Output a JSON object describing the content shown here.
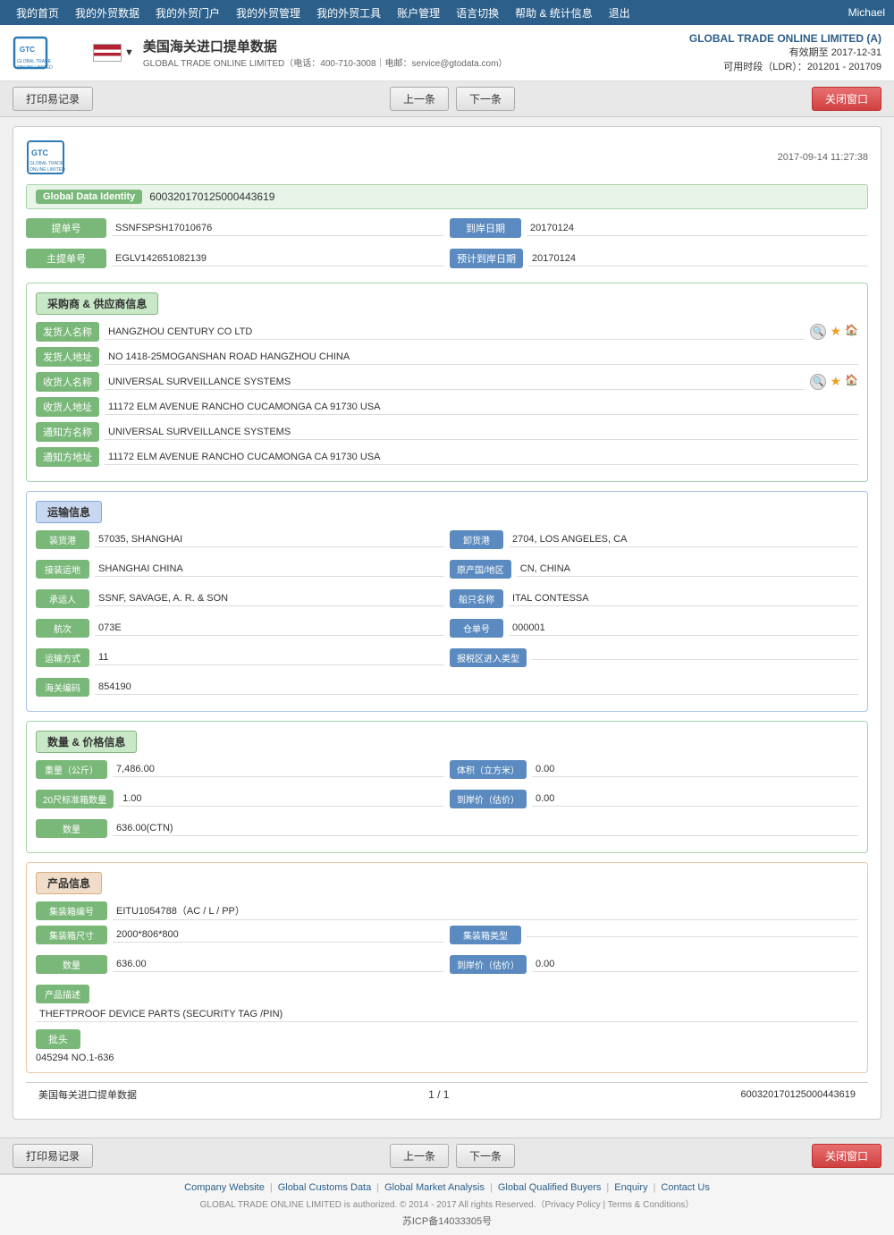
{
  "topnav": {
    "items": [
      {
        "label": "我的首页",
        "id": "home"
      },
      {
        "label": "我的外贸数据",
        "id": "data"
      },
      {
        "label": "我的外贸门户",
        "id": "portal"
      },
      {
        "label": "我的外贸管理",
        "id": "manage"
      },
      {
        "label": "我的外贸工具",
        "id": "tools"
      },
      {
        "label": "账户管理",
        "id": "account"
      },
      {
        "label": "语言切换",
        "id": "lang"
      },
      {
        "label": "帮助 & 统计信息",
        "id": "help"
      },
      {
        "label": "退出",
        "id": "logout"
      }
    ],
    "user": "Michael"
  },
  "header": {
    "title": "美国海关进口提单数据",
    "subtitle": "GLOBAL TRADE ONLINE LIMITED（电话：400-710-3008｜电邮：service@gtodata.com）",
    "brand": "GLOBAL TRADE ONLINE LIMITED (A)",
    "expiry_label": "有效期至",
    "expiry_date": "2017-12-31",
    "time_label": "可用时段（LDR）：",
    "time_range": "201201 - 201709"
  },
  "toolbar": {
    "print_label": "打印易记录",
    "prev_label": "上一条",
    "next_label": "下一条",
    "close_label": "关闭窗口"
  },
  "card": {
    "datetime": "2017-09-14 11:27:38",
    "global_data_label": "Global Data Identity",
    "global_data_value": "600320170125000443619",
    "fields": {
      "ti_dan_hao": {
        "label": "提单号",
        "value": "SSNFSPSH17010676"
      },
      "dao_an_ri_qi": {
        "label": "到岸日期",
        "value": "20170124"
      },
      "zhu_ti_dan_hao": {
        "label": "主提单号",
        "value": "EGLV142651082139"
      },
      "yu_ji_dao_an_ri_qi": {
        "label": "预计到岸日期",
        "value": "20170124"
      }
    }
  },
  "supplier_section": {
    "title": "采购商 & 供应商信息",
    "fields": {
      "fa_huo_ren_mingcheng": {
        "label": "发货人名称",
        "value": "HANGZHOU CENTURY CO LTD"
      },
      "fa_huo_ren_dizhi": {
        "label": "发货人地址",
        "value": "NO 1418-25MOGANSHAN ROAD HANGZHOU CHINA"
      },
      "shou_huo_ren_mingcheng": {
        "label": "收货人名称",
        "value": "UNIVERSAL SURVEILLANCE SYSTEMS"
      },
      "shou_huo_ren_dizhi": {
        "label": "收货人地址",
        "value": "11172 ELM AVENUE RANCHO CUCAMONGA CA 91730 USA"
      },
      "tong_zhi_fang_mingcheng": {
        "label": "通知方名称",
        "value": "UNIVERSAL SURVEILLANCE SYSTEMS"
      },
      "tong_zhi_fang_dizhi": {
        "label": "通知方地址",
        "value": "11172 ELM AVENUE RANCHO CUCAMONGA CA 91730 USA"
      }
    }
  },
  "transport_section": {
    "title": "运输信息",
    "fields": {
      "zhuang_huo_gang": {
        "label": "装货港",
        "value": "57035, SHANGHAI"
      },
      "xie_huo_gang": {
        "label": "卸货港",
        "value": "2704, LOS ANGELES, CA"
      },
      "zhao_zhuang_yunlu": {
        "label": "接装运地",
        "value": "SHANGHAI CHINA"
      },
      "yuan_chan_guo_diqu": {
        "label": "原产国/地区",
        "value": "CN, CHINA"
      },
      "cheng_yun_ren": {
        "label": "承运人",
        "value": "SSNF, SAVAGE, A. R. & SON"
      },
      "chuan_ming_mingcheng": {
        "label": "船只名称",
        "value": "ITAL CONTESSA"
      },
      "hang_ci": {
        "label": "航次",
        "value": "073E"
      },
      "cang_dan_hao": {
        "label": "仓单号",
        "value": "000001"
      },
      "yun_shu_fangshi": {
        "label": "运输方式",
        "value": "11"
      },
      "guan_shui_qu_jinchukou_leixing": {
        "label": "报税区进入类型",
        "value": ""
      },
      "hai_guan_bianhao": {
        "label": "海关编码",
        "value": "854190"
      }
    }
  },
  "quantity_section": {
    "title": "数量 & 价格信息",
    "fields": {
      "zhongliang_kg": {
        "label": "重量（公斤）",
        "value": "7,486.00"
      },
      "tiji_m3": {
        "label": "体积（立方米）",
        "value": "0.00"
      },
      "standard_box_20": {
        "label": "20尺标准箱数量",
        "value": "1.00"
      },
      "dao_an_jia_gu": {
        "label": "到岸价（估价）",
        "value": "0.00"
      },
      "shu_liang": {
        "label": "数量",
        "value": "636.00(CTN)"
      }
    }
  },
  "product_section": {
    "title": "产品信息",
    "fields": {
      "ji_zhuang_xiang_bianhao": {
        "label": "集装箱编号",
        "value": "EITU1054788（AC / L / PP）"
      },
      "ji_zhuang_xiang_chicun": {
        "label": "集装箱尺寸",
        "value": "2000*806*800"
      },
      "ji_zhuang_xiang_leixing": {
        "label": "集装箱类型",
        "value": ""
      },
      "shu_liang": {
        "label": "数量",
        "value": "636.00"
      },
      "dao_an_jia_gu": {
        "label": "到岸价（估价）",
        "value": "0.00"
      },
      "chan_pin_miaoshu": {
        "label": "产品描述",
        "value": "THEFTPROOF DEVICE PARTS (SECURITY TAG /PIN)"
      },
      "pi_tou": {
        "label": "批头",
        "value": ""
      },
      "pi_tou_value": "045294 NO.1-636"
    }
  },
  "footer": {
    "info_label": "美国每关进口提单数据",
    "page": "1 / 1",
    "id": "600320170125000443619"
  },
  "bottom_toolbar": {
    "print_label": "打印易记录",
    "prev_label": "上一条",
    "next_label": "下一条",
    "close_label": "关闭窗口"
  },
  "site_footer": {
    "links": [
      {
        "label": "Company Website"
      },
      {
        "label": "Global Customs Data"
      },
      {
        "label": "Global Market Analysis"
      },
      {
        "label": "Global Qualified Buyers"
      },
      {
        "label": "Enquiry"
      },
      {
        "label": "Contact Us"
      }
    ],
    "copyright": "GLOBAL TRADE ONLINE LIMITED is authorized. © 2014 - 2017 All rights Reserved.（Privacy Policy | Terms & Conditions）",
    "icp": "苏ICP备14033305号"
  }
}
